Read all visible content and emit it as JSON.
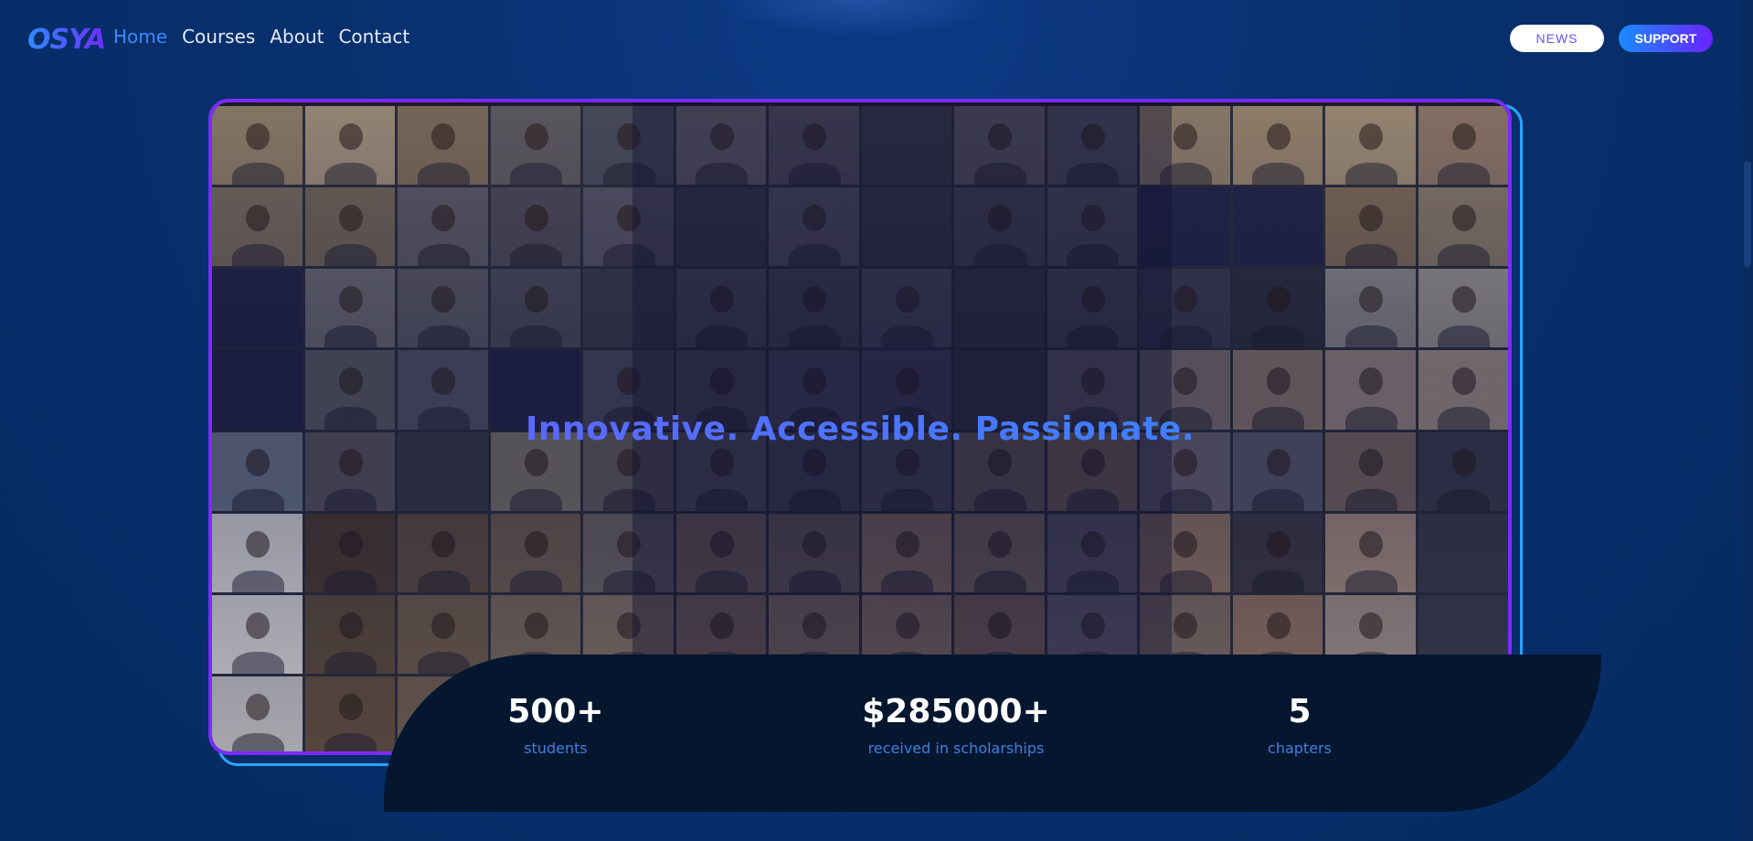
{
  "brand": {
    "logo_text": "OSYA"
  },
  "nav": {
    "links": [
      "Home",
      "Courses",
      "About",
      "Contact"
    ],
    "active": "Home",
    "news_label": "NEWS",
    "support_label": "SUPPORT"
  },
  "hero": {
    "tagline": "Innovative. Accessible. Passionate.",
    "collage_image": "video-call-collage"
  },
  "stats": [
    {
      "value": "500+",
      "label": "students"
    },
    {
      "value": "$285000+",
      "label": "received in scholarships"
    },
    {
      "value": "5",
      "label": "chapters"
    }
  ],
  "colors": {
    "background": "#08306e",
    "accent_blue": "#2f8cff",
    "accent_purple": "#6a22ff",
    "stats_panel": "#05162f",
    "stat_label": "#3e7fe0"
  }
}
